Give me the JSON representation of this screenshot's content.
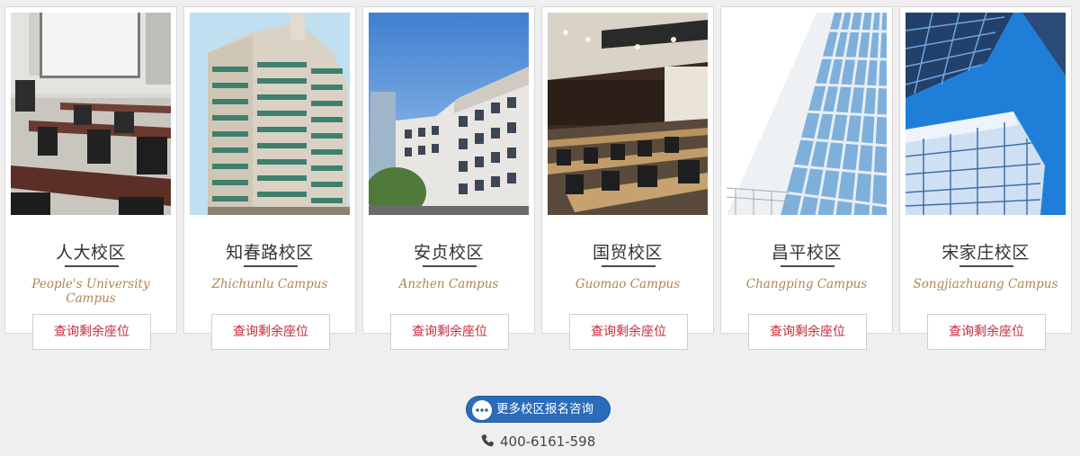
{
  "campuses": [
    {
      "name_cn": "人大校区",
      "name_en": "People's University Campus",
      "button_label": "查询剩余座位",
      "photo": "classroom-photo"
    },
    {
      "name_cn": "知春路校区",
      "name_en": "Zhichunlu Campus",
      "button_label": "查询剩余座位",
      "photo": "office-tower-photo"
    },
    {
      "name_cn": "安贞校区",
      "name_en": "Anzhen Campus",
      "button_label": "查询剩余座位",
      "photo": "office-building-photo"
    },
    {
      "name_cn": "国贸校区",
      "name_en": "Guomao Campus",
      "button_label": "查询剩余座位",
      "photo": "lecture-hall-photo"
    },
    {
      "name_cn": "昌平校区",
      "name_en": "Changping Campus",
      "button_label": "查询剩余座位",
      "photo": "glass-facade-photo"
    },
    {
      "name_cn": "宋家庄校区",
      "name_en": "Songjiazhuang Campus",
      "button_label": "查询剩余座位",
      "photo": "skyscrapers-photo"
    }
  ],
  "consult": {
    "label": "更多校区报名咨询",
    "icon": "chat-bubble-icon"
  },
  "phone": {
    "number": "400-6161-598",
    "icon": "phone-icon"
  },
  "colors": {
    "accent_red": "#c8283c",
    "english_gold": "#b08552",
    "button_blue": "#2b6bb8",
    "background": "#efefef"
  }
}
